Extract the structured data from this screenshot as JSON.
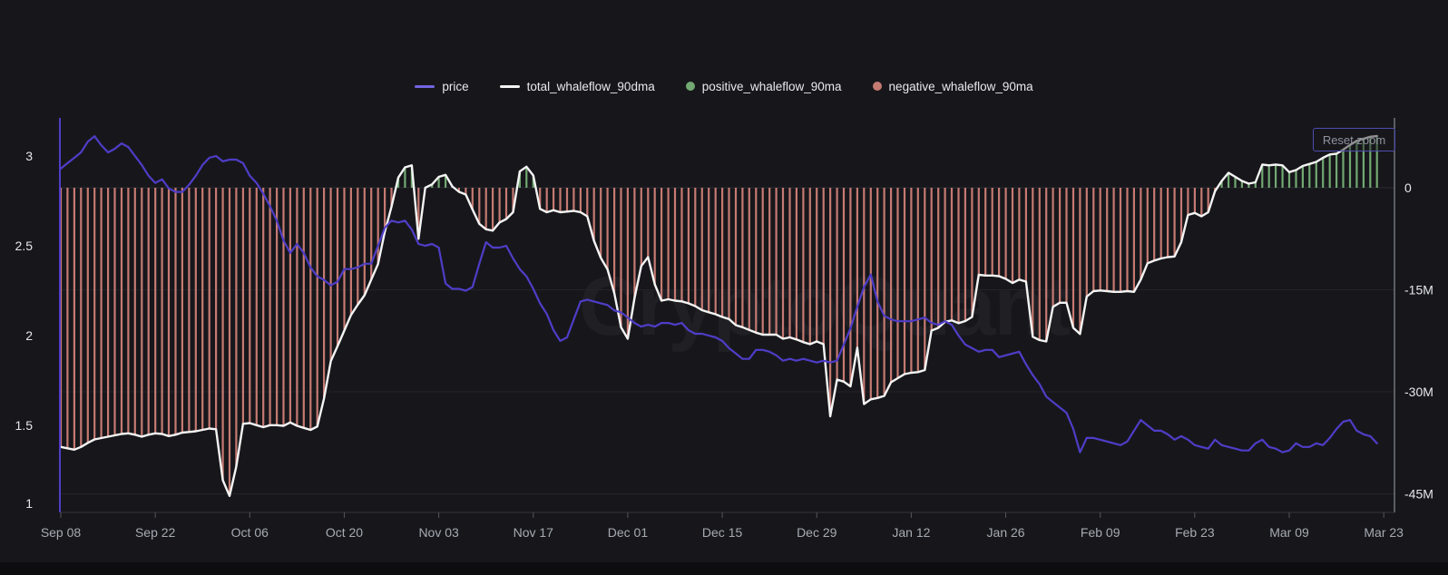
{
  "app": {
    "watermark": "CryptoQuant",
    "background": "#17171b"
  },
  "controls": {
    "reset_zoom_label": "Reset zoom"
  },
  "legend": [
    {
      "label": "price",
      "marker": "line",
      "color": "#7365e0"
    },
    {
      "label": "total_whaleflow_90dma",
      "marker": "line",
      "color": "#f4f4f4"
    },
    {
      "label": "positive_whaleflow_90ma",
      "marker": "dot",
      "color": "#72a872"
    },
    {
      "label": "negative_whaleflow_90ma",
      "marker": "dot",
      "color": "#c57a72"
    }
  ],
  "chart_data": {
    "type": "mixed",
    "title": "",
    "legend_position": "top-center",
    "watermark": "CryptoQuant",
    "x": {
      "unit": "days",
      "count": 196,
      "start_label": "Sep 08",
      "end_label": "Mar 23",
      "tick_positions": [
        0,
        14,
        28,
        42,
        56,
        70,
        84,
        98,
        112,
        126,
        140,
        154,
        168,
        182,
        196
      ],
      "tick_labels": [
        "Sep 08",
        "Sep 22",
        "Oct 06",
        "Oct 20",
        "Nov 03",
        "Nov 17",
        "Dec 01",
        "Dec 15",
        "Dec 29",
        "Jan 12",
        "Jan 26",
        "Feb 09",
        "Feb 23",
        "Mar 09",
        "Mar 23"
      ]
    },
    "axes": {
      "left": {
        "series": "price",
        "tick_values": [
          3,
          2.5,
          2,
          1.5,
          1
        ],
        "tick_labels": [
          "3",
          "2.5",
          "2",
          "1.5",
          "1"
        ],
        "range": [
          0.98,
          3.21
        ],
        "axis_line_color": "#4f3dc8",
        "label_color": "#e6e7ea"
      },
      "right": {
        "series": "whaleflow (millions)",
        "tick_values": [
          0,
          -15,
          -30,
          -45
        ],
        "tick_labels": [
          "0",
          "-15M",
          "-30M",
          "-45M"
        ],
        "range_millions": [
          -48,
          10.3
        ],
        "axis_line_color": "#9fa3ab",
        "label_color": "#e6e7ea"
      },
      "bottom": {
        "label_color": "#a6aab2",
        "baseline_color": "#33343a",
        "tick_color": "#55565c"
      }
    },
    "grid": {
      "horizontal_at_right_axis_values": [
        0,
        -15,
        -30,
        -45
      ],
      "color": "#232329"
    },
    "series": [
      {
        "name": "price",
        "axis": "left",
        "type": "line",
        "color": "#4f3dc8",
        "values": [
          2.93,
          2.96,
          2.99,
          3.02,
          3.08,
          3.11,
          3.06,
          3.02,
          3.04,
          3.07,
          3.05,
          3.0,
          2.95,
          2.89,
          2.85,
          2.87,
          2.82,
          2.8,
          2.8,
          2.84,
          2.89,
          2.95,
          2.99,
          3.0,
          2.97,
          2.98,
          2.98,
          2.96,
          2.89,
          2.85,
          2.79,
          2.72,
          2.64,
          2.53,
          2.46,
          2.51,
          2.46,
          2.38,
          2.33,
          2.31,
          2.28,
          2.3,
          2.37,
          2.37,
          2.38,
          2.4,
          2.4,
          2.5,
          2.6,
          2.64,
          2.63,
          2.64,
          2.59,
          2.51,
          2.5,
          2.51,
          2.49,
          2.29,
          2.26,
          2.26,
          2.25,
          2.27,
          2.4,
          2.52,
          2.49,
          2.49,
          2.5,
          2.43,
          2.37,
          2.33,
          2.26,
          2.18,
          2.12,
          2.03,
          1.97,
          1.99,
          2.09,
          2.19,
          2.2,
          2.19,
          2.18,
          2.17,
          2.14,
          2.13,
          2.1,
          2.07,
          2.05,
          2.06,
          2.05,
          2.07,
          2.07,
          2.06,
          2.07,
          2.03,
          2.01,
          2.01,
          2.0,
          1.99,
          1.97,
          1.93,
          1.9,
          1.87,
          1.87,
          1.92,
          1.92,
          1.91,
          1.89,
          1.86,
          1.87,
          1.86,
          1.87,
          1.86,
          1.85,
          1.86,
          1.85,
          1.86,
          1.95,
          2.04,
          2.16,
          2.27,
          2.34,
          2.19,
          2.11,
          2.09,
          2.08,
          2.08,
          2.08,
          2.09,
          2.1,
          2.07,
          2.06,
          2.08,
          2.06,
          2.0,
          1.95,
          1.93,
          1.91,
          1.92,
          1.92,
          1.88,
          1.89,
          1.9,
          1.91,
          1.84,
          1.78,
          1.73,
          1.66,
          1.63,
          1.6,
          1.57,
          1.48,
          1.35,
          1.43,
          1.43,
          1.42,
          1.41,
          1.4,
          1.39,
          1.41,
          1.47,
          1.53,
          1.5,
          1.47,
          1.47,
          1.45,
          1.42,
          1.44,
          1.42,
          1.39,
          1.38,
          1.37,
          1.42,
          1.39,
          1.38,
          1.37,
          1.36,
          1.36,
          1.4,
          1.42,
          1.38,
          1.37,
          1.35,
          1.36,
          1.4,
          1.38,
          1.38,
          1.4,
          1.39,
          1.43,
          1.48,
          1.52,
          1.53,
          1.47,
          1.45,
          1.44,
          1.4
        ]
      },
      {
        "name": "total_whaleflow_90dma",
        "axis": "right",
        "type": "line",
        "unit": "millions",
        "color": "#f4f4f4",
        "values": [
          -38.1,
          -38.3,
          -38.5,
          -38.1,
          -37.5,
          -37.0,
          -36.8,
          -36.6,
          -36.4,
          -36.2,
          -36.1,
          -36.3,
          -36.6,
          -36.3,
          -36.1,
          -36.2,
          -36.5,
          -36.3,
          -36.0,
          -35.9,
          -35.8,
          -35.6,
          -35.4,
          -35.5,
          -43.0,
          -45.3,
          -41.0,
          -34.7,
          -34.6,
          -34.9,
          -35.2,
          -34.9,
          -34.9,
          -35.0,
          -34.5,
          -35.0,
          -35.3,
          -35.6,
          -35.1,
          -31.0,
          -25.5,
          -23.3,
          -21.0,
          -18.7,
          -17.2,
          -15.8,
          -13.5,
          -11.2,
          -6.5,
          -2.8,
          1.5,
          3.0,
          3.3,
          -7.5,
          0.0,
          0.5,
          1.6,
          1.9,
          0.2,
          -0.6,
          -1.0,
          -3.2,
          -5.3,
          -6.1,
          -6.3,
          -5.1,
          -4.6,
          -3.6,
          2.4,
          3.1,
          1.8,
          -3.1,
          -3.6,
          -3.3,
          -3.6,
          -3.5,
          -3.4,
          -3.6,
          -4.2,
          -7.8,
          -10.3,
          -12.0,
          -15.5,
          -20.5,
          -22.2,
          -16.2,
          -11.5,
          -10.2,
          -14.2,
          -16.6,
          -16.4,
          -16.6,
          -16.7,
          -17.0,
          -17.4,
          -18.0,
          -18.3,
          -18.6,
          -19.0,
          -19.3,
          -20.2,
          -20.5,
          -20.9,
          -21.3,
          -21.6,
          -21.6,
          -21.6,
          -22.2,
          -22.0,
          -22.3,
          -22.7,
          -23.0,
          -22.6,
          -23.0,
          -33.6,
          -28.2,
          -28.5,
          -29.2,
          -23.5,
          -31.8,
          -31.1,
          -30.9,
          -30.6,
          -28.6,
          -28.0,
          -27.4,
          -27.2,
          -27.1,
          -26.8,
          -21.0,
          -20.6,
          -19.7,
          -19.5,
          -19.9,
          -19.6,
          -19.0,
          -12.8,
          -12.9,
          -12.9,
          -13.0,
          -13.4,
          -14.0,
          -13.5,
          -13.8,
          -21.9,
          -22.4,
          -22.6,
          -17.5,
          -16.9,
          -16.9,
          -20.6,
          -21.5,
          -16.0,
          -15.2,
          -15.1,
          -15.2,
          -15.3,
          -15.3,
          -15.2,
          -15.3,
          -13.5,
          -11.1,
          -10.7,
          -10.4,
          -10.2,
          -10.1,
          -8.0,
          -4.0,
          -3.7,
          -4.2,
          -3.6,
          -0.5,
          1.0,
          2.2,
          1.6,
          1.0,
          0.6,
          0.8,
          3.4,
          3.3,
          3.4,
          3.3,
          2.3,
          2.6,
          3.2,
          3.5,
          3.8,
          4.4,
          4.9,
          5.0,
          5.6,
          6.3,
          6.9,
          7.2,
          7.5,
          7.6
        ]
      },
      {
        "name": "positive_whaleflow_90ma",
        "axis": "right",
        "type": "bar",
        "color": "#72a872",
        "derived": "bars drawn from 0 up to total_whaleflow_90dma value on days where it is positive"
      },
      {
        "name": "negative_whaleflow_90ma",
        "axis": "right",
        "type": "bar",
        "color": "#c57a72",
        "derived": "bars drawn from 0 down to total_whaleflow_90dma value on days where it is negative"
      }
    ]
  }
}
